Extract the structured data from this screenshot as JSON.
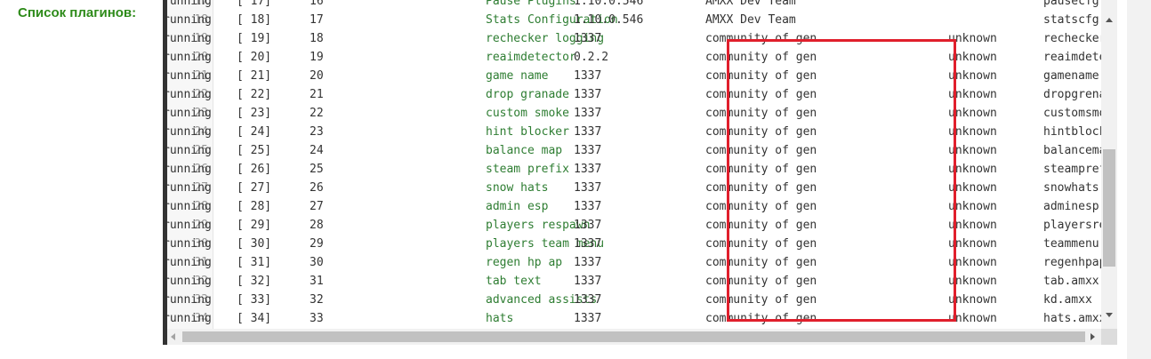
{
  "title": "Список плагинов:",
  "rows": [
    {
      "ln": "17",
      "idx": "[ 17]",
      "num": "16",
      "name": "Pause Plugins",
      "ver": "1.10.0.546",
      "author": "AMXX Dev Team",
      "file": "pausecfg.am",
      "status": "running"
    },
    {
      "ln": "18",
      "idx": "[ 18]",
      "num": "17",
      "name": "Stats Configuration",
      "ver": "1.10.0.546",
      "author": "AMXX Dev Team",
      "file": "statscfg.am",
      "status": "running"
    },
    {
      "ln": "19",
      "idx": "[ 19]",
      "num": "18",
      "name": "rechecker logging",
      "ver": "1337",
      "author": "community of gen",
      "flag": "unknown",
      "file": "rechecker.a",
      "status": "running"
    },
    {
      "ln": "20",
      "idx": "[ 20]",
      "num": "19",
      "name": "reaimdetector",
      "ver": "0.2.2",
      "author": "community of gen",
      "flag": "unknown",
      "file": "reaimdetect",
      "status": "running"
    },
    {
      "ln": "21",
      "idx": "[ 21]",
      "num": "20",
      "name": "game name",
      "ver": "1337",
      "author": "community of gen",
      "flag": "unknown",
      "file": "gamename.am",
      "status": "running"
    },
    {
      "ln": "22",
      "idx": "[ 22]",
      "num": "21",
      "name": "drop granade",
      "ver": "1337",
      "author": "community of gen",
      "flag": "unknown",
      "file": "dropgrenade",
      "status": "running"
    },
    {
      "ln": "23",
      "idx": "[ 23]",
      "num": "22",
      "name": "custom smoke",
      "ver": "1337",
      "author": "community of gen",
      "flag": "unknown",
      "file": "customsmoke",
      "status": "running"
    },
    {
      "ln": "24",
      "idx": "[ 24]",
      "num": "23",
      "name": "hint blocker",
      "ver": "1337",
      "author": "community of gen",
      "flag": "unknown",
      "file": "hintblocker",
      "status": "running"
    },
    {
      "ln": "25",
      "idx": "[ 25]",
      "num": "24",
      "name": "balance map",
      "ver": "1337",
      "author": "community of gen",
      "flag": "unknown",
      "file": "balancemap.",
      "status": "running"
    },
    {
      "ln": "26",
      "idx": "[ 26]",
      "num": "25",
      "name": "steam prefix",
      "ver": "1337",
      "author": "community of gen",
      "flag": "unknown",
      "file": "steampref.a",
      "status": "running"
    },
    {
      "ln": "27",
      "idx": "[ 27]",
      "num": "26",
      "name": "snow hats",
      "ver": "1337",
      "author": "community of gen",
      "flag": "unknown",
      "file": "snowhats.am",
      "status": "running"
    },
    {
      "ln": "28",
      "idx": "[ 28]",
      "num": "27",
      "name": "admin esp",
      "ver": "1337",
      "author": "community of gen",
      "flag": "unknown",
      "file": "adminesp.am",
      "status": "running"
    },
    {
      "ln": "29",
      "idx": "[ 29]",
      "num": "28",
      "name": "players respawn",
      "ver": "1337",
      "author": "community of gen",
      "flag": "unknown",
      "file": "playersresp",
      "status": "running"
    },
    {
      "ln": "30",
      "idx": "[ 30]",
      "num": "29",
      "name": "players team menu",
      "ver": "1337",
      "author": "community of gen",
      "flag": "unknown",
      "file": "teammenu.am",
      "status": "running"
    },
    {
      "ln": "31",
      "idx": "[ 31]",
      "num": "30",
      "name": "regen hp ap",
      "ver": "1337",
      "author": "community of gen",
      "flag": "unknown",
      "file": "regenhpap.a",
      "status": "running"
    },
    {
      "ln": "32",
      "idx": "[ 32]",
      "num": "31",
      "name": "tab text",
      "ver": "1337",
      "author": "community of gen",
      "flag": "unknown",
      "file": "tab.amxx",
      "status": "running"
    },
    {
      "ln": "33",
      "idx": "[ 33]",
      "num": "32",
      "name": "advanced assists",
      "ver": "1337",
      "author": "community of gen",
      "flag": "unknown",
      "file": "kd.amxx",
      "status": "running"
    },
    {
      "ln": "34",
      "idx": "[ 34]",
      "num": "33",
      "name": "hats",
      "ver": "1337",
      "author": "community of gen",
      "flag": "unknown",
      "file": "hats.amxx",
      "status": "running"
    }
  ],
  "highlight_color": "#e01f2c"
}
